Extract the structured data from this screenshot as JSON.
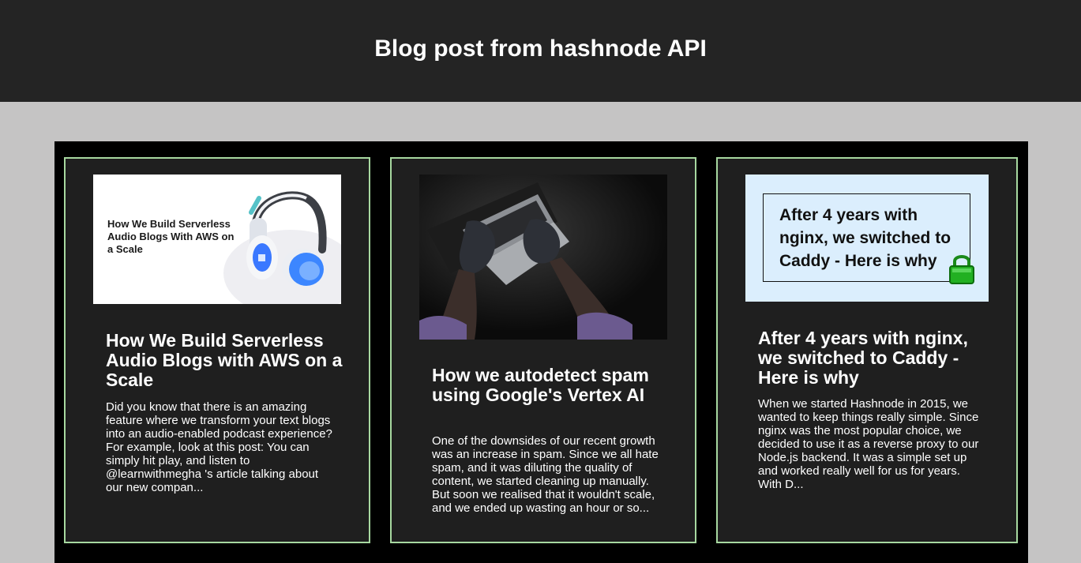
{
  "header": {
    "title": "Blog post from hashnode API"
  },
  "posts": [
    {
      "image_text": "How We Build Serverless Audio Blogs With AWS on a Scale",
      "image_icon": "headphones-icon",
      "title": "How We Build Serverless Audio Blogs with AWS on a Scale",
      "excerpt": "Did you know that there is an amazing feature where we transform your text blogs into an audio-enabled podcast experience? For example, look at this post: You can simply hit play, and listen to @learnwithmegha 's article talking about our new compan..."
    },
    {
      "image_icon": "laptop-hands-photo",
      "title": "How we autodetect spam using Google's Vertex AI",
      "excerpt": "One of the downsides of our recent growth was an increase in spam. Since we all hate spam, and it was diluting the quality of content, we started cleaning up manually. But soon we realised that it wouldn't scale, and we ended up wasting an hour or so..."
    },
    {
      "image_text": "After 4 years with nginx, we switched to Caddy - Here is why",
      "image_icon": "padlock-icon",
      "title": "After 4 years with nginx, we switched to Caddy - Here is why",
      "excerpt": "When we started Hashnode in 2015, we wanted to keep things really simple. Since nginx was the most popular choice, we decided to use it as a reverse proxy to our Node.js backend. It was a simple set up and worked really well for us for years. With D..."
    }
  ],
  "colors": {
    "header_bg": "#242424",
    "page_bg": "#c5c4c4",
    "card_border": "#a7d8a0",
    "card_bg": "#1f1f1f"
  }
}
